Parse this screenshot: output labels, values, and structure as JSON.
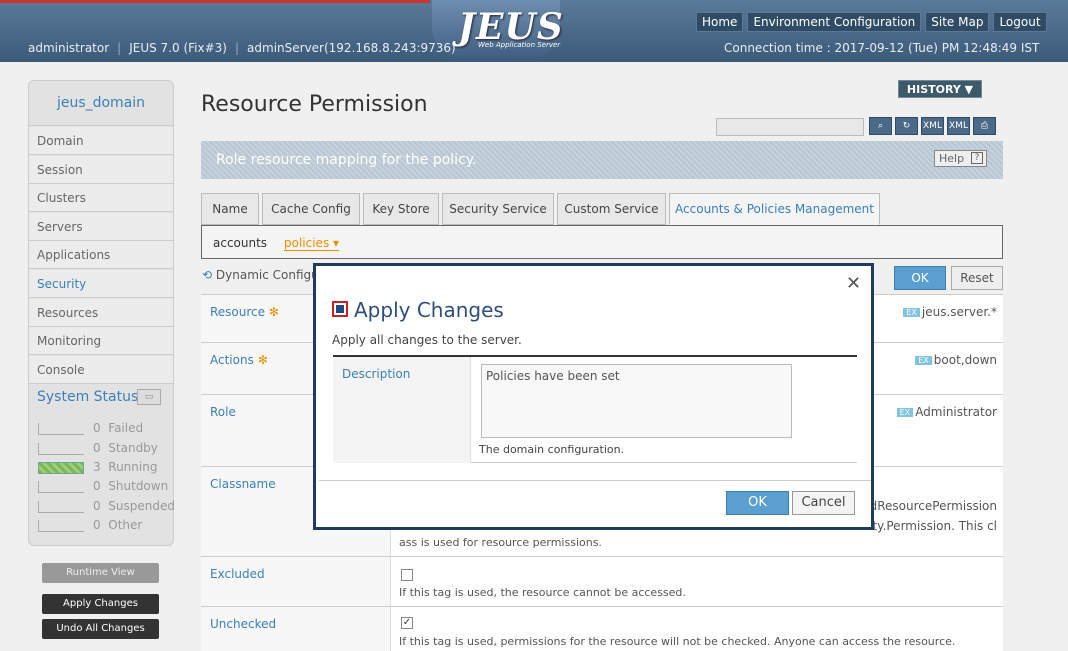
{
  "header": {
    "logo_text": "JEUS",
    "logo_sub": "Web Application Server",
    "nav": [
      "Home",
      "Environment Configuration",
      "Site Map",
      "Logout"
    ],
    "user": "administrator",
    "version": "JEUS 7.0 (Fix#3)",
    "server": "adminServer(192.168.8.243:9736)",
    "connection_time": "Connection time : 2017-09-12 (Tue) PM 12:48:49 IST"
  },
  "sidebar": {
    "domain": "jeus_domain",
    "items": [
      "Domain",
      "Session",
      "Clusters",
      "Servers",
      "Applications",
      "Security",
      "Resources",
      "Monitoring",
      "Console"
    ],
    "active": "Security",
    "system_status_title": "System Status",
    "statuses": [
      {
        "count": "0",
        "label": "Failed"
      },
      {
        "count": "0",
        "label": "Standby"
      },
      {
        "count": "3",
        "label": "Running"
      },
      {
        "count": "0",
        "label": "Shutdown"
      },
      {
        "count": "0",
        "label": "Suspended"
      },
      {
        "count": "0",
        "label": "Other"
      }
    ],
    "runtime_view": "Runtime View",
    "apply_changes": "Apply Changes",
    "undo_changes": "Undo All Changes"
  },
  "main": {
    "title": "Resource Permission",
    "history": "HISTORY ▼",
    "banner": "Role resource mapping for the policy.",
    "help": "Help",
    "tabs": [
      "Name",
      "Cache Config",
      "Key Store",
      "Security Service",
      "Custom Service",
      "Accounts & Policies Management"
    ],
    "subnav_accounts": "accounts",
    "subnav_policies": "policies ▾",
    "dynamic_config": "Dynamic Configu",
    "ok": "OK",
    "reset": "Reset",
    "rows": {
      "resource": {
        "label": "Resource",
        "value": "jeus.server.*"
      },
      "actions": {
        "label": "Actions",
        "value": "boot,down"
      },
      "role": {
        "label": "Role",
        "value": "Administrator"
      },
      "classname": {
        "label": "Classname",
        "value1": "edResourcePermission",
        "value2": "urity.Permission. This cl",
        "desc": "ass is used for resource permissions."
      },
      "excluded": {
        "label": "Excluded",
        "desc": "If this tag is used, the resource cannot be accessed."
      },
      "unchecked": {
        "label": "Unchecked",
        "desc": "If this tag is used, permissions for the resource will not be checked. Anyone can access the resource."
      }
    },
    "ex_badge": "EX"
  },
  "dialog": {
    "title": "Apply Changes",
    "subtitle": "Apply all changes to the server.",
    "field_label": "Description",
    "field_value": "Policies have been set",
    "note": "The domain configuration.",
    "ok": "OK",
    "cancel": "Cancel"
  }
}
